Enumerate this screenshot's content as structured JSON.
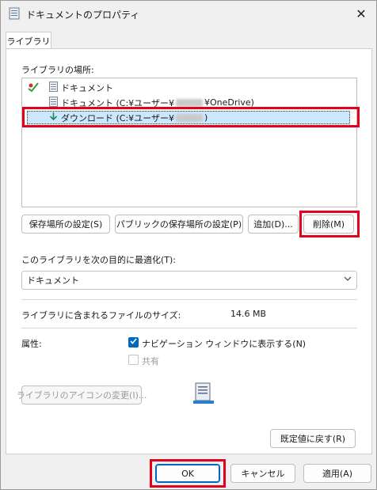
{
  "window": {
    "title": "ドキュメントのプロパティ",
    "close_glyph": "✕"
  },
  "tab": {
    "label": "ライブラリ"
  },
  "library_locations": {
    "heading": "ライブラリの場所:",
    "items": [
      {
        "label": "ドキュメント"
      },
      {
        "label_prefix": "ドキュメント (C:¥ユーザー¥",
        "label_suffix": "¥OneDrive)"
      },
      {
        "label_prefix": "ダウンロード (C:¥ユーザー¥",
        "label_suffix": ")"
      }
    ]
  },
  "buttons": {
    "set_save_location": "保存場所の設定(S)",
    "set_public_save_location": "パブリックの保存場所の設定(P)",
    "add": "追加(D)...",
    "remove": "削除(M)",
    "change_icon": "ライブラリのアイコンの変更(I)...",
    "restore_defaults": "既定値に戻す(R)",
    "ok": "OK",
    "cancel": "キャンセル",
    "apply": "適用(A)"
  },
  "optimize": {
    "label": "このライブラリを次の目的に最適化(T):",
    "selected": "ドキュメント"
  },
  "size": {
    "label": "ライブラリに含まれるファイルのサイズ:",
    "value": "14.6 MB"
  },
  "attributes": {
    "label": "属性:",
    "show_in_nav": "ナビゲーション ウィンドウに表示する(N)",
    "shared": "共有"
  },
  "colors": {
    "highlight_red": "#e3001b",
    "accent": "#0067c0",
    "selection": "#cce8ff"
  }
}
